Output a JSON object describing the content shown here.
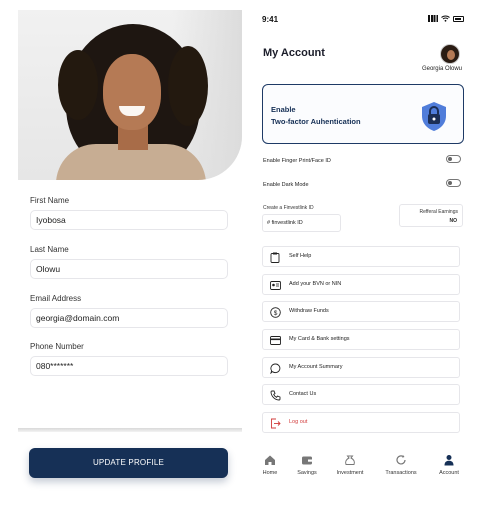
{
  "profile": {
    "fields": [
      {
        "label": "First Name",
        "value": "Iyobosa"
      },
      {
        "label": "Last Name",
        "value": "Olowu"
      },
      {
        "label": "Email  Address",
        "value": "georgia@domain.com"
      },
      {
        "label": "Phone Number",
        "value": "080*******"
      }
    ],
    "update_button": "UPDATE PROFILE"
  },
  "status_bar": {
    "time": "9:41"
  },
  "account": {
    "title": "My Account",
    "user_name": "Georgia Olowu",
    "twofa": {
      "line1": "Enable",
      "line2": "Two-factor Auhentication"
    },
    "toggles": [
      {
        "label": "Enable Finger Print/Face ID"
      },
      {
        "label": "Enable Dark Mode"
      }
    ],
    "link_label": "Create a Finvestlink ID",
    "link_value": "# finvestlink ID",
    "referral": {
      "label": "Refferal Earnings",
      "value": "NO"
    },
    "menu": [
      {
        "label": "Self Help",
        "icon": "clipboard-icon"
      },
      {
        "label": "Add your BVN or NIN",
        "icon": "id-card-icon"
      },
      {
        "label": "Withdraw Funds",
        "icon": "dollar-coin-icon"
      },
      {
        "label": "My Card & Bank settings",
        "icon": "credit-card-icon"
      },
      {
        "label": "My Account  Summary",
        "icon": "chat-bubble-icon"
      },
      {
        "label": "Contact Us",
        "icon": "phone-icon"
      },
      {
        "label": "Log out",
        "icon": "logout-icon"
      }
    ],
    "logout_color": "#d13b3b"
  },
  "tabbar": [
    {
      "label": "Home",
      "icon": "home-icon"
    },
    {
      "label": "Savings",
      "icon": "wallet-icon"
    },
    {
      "label": "Investment",
      "icon": "bag-icon"
    },
    {
      "label": "Transactions",
      "icon": "refresh-icon"
    },
    {
      "label": "Account",
      "icon": "person-icon"
    }
  ],
  "colors": {
    "primary": "#163056",
    "border": "#e6e6ea"
  }
}
